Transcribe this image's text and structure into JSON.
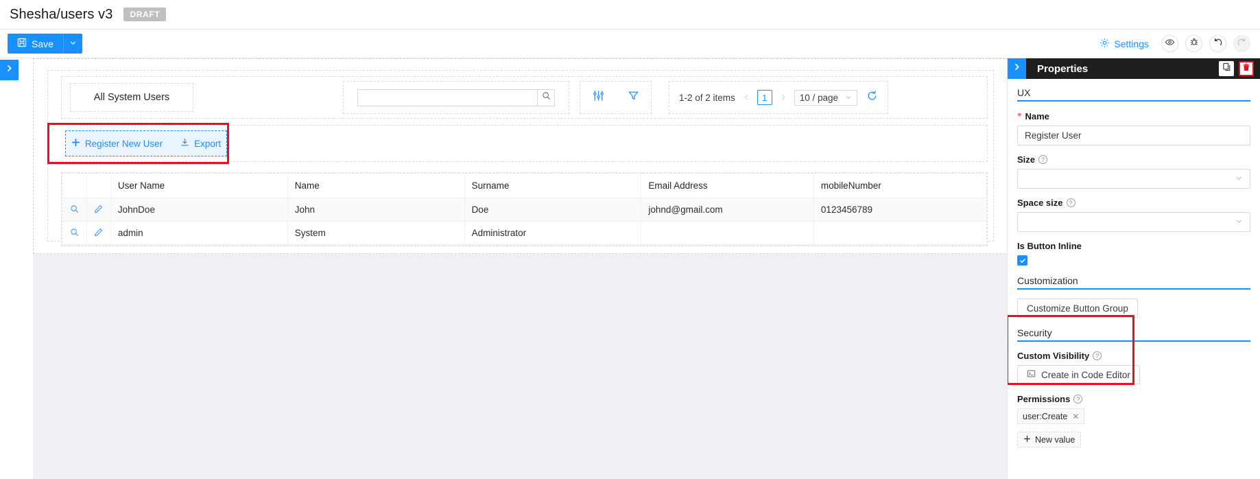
{
  "header": {
    "title": "Shesha/users v3",
    "badge": "DRAFT"
  },
  "toolbar": {
    "save_label": "Save",
    "save_icon": "save-icon",
    "caret_icon": "chevron-down-icon",
    "settings_label": "Settings",
    "settings_icon": "gear-icon",
    "actions": [
      {
        "name": "preview-icon",
        "glyph": "eye"
      },
      {
        "name": "debug-icon",
        "glyph": "bug"
      },
      {
        "name": "undo-icon",
        "glyph": "undo"
      },
      {
        "name": "redo-icon",
        "glyph": "redo"
      }
    ]
  },
  "left_handle": {
    "icon": "chevron-right-icon"
  },
  "canvas": {
    "quickview_label": "All System Users",
    "search": {
      "value": "",
      "placeholder": "",
      "icon": "search-icon"
    },
    "table_icons": [
      {
        "name": "column-settings-icon"
      },
      {
        "name": "filter-icon"
      }
    ],
    "pagination": {
      "range_text": "1-2 of 2 items",
      "prev_icon": "chevron-left-icon",
      "current_page": "1",
      "next_icon": "chevron-right-icon",
      "page_size": "10 / page",
      "page_size_caret": "chevron-down-icon",
      "refresh_icon": "refresh-icon"
    },
    "button_group": {
      "selected": true,
      "buttons": [
        {
          "label": "Register New User",
          "icon": "plus-icon"
        },
        {
          "label": "Export",
          "icon": "download-icon"
        }
      ]
    },
    "table": {
      "columns": [
        "",
        "",
        "User Name",
        "Name",
        "Surname",
        "Email Address",
        "mobileNumber"
      ],
      "row_actions": [
        "view-icon",
        "edit-icon"
      ],
      "rows": [
        {
          "user_name": "JohnDoe",
          "name": "John",
          "surname": "Doe",
          "email": "johnd@gmail.com",
          "mobile": "0123456789"
        },
        {
          "user_name": "admin",
          "name": "System",
          "surname": "Administrator",
          "email": "",
          "mobile": ""
        }
      ]
    }
  },
  "properties": {
    "collapse_icon": "chevron-right-icon",
    "title": "Properties",
    "copy_icon": "copy-icon",
    "delete_icon": "trash-icon",
    "sections": {
      "ux": "UX",
      "customization": "Customization",
      "security": "Security"
    },
    "fields": {
      "name_label": "Name",
      "name_value": "Register User",
      "size_label": "Size",
      "size_value": "",
      "space_size_label": "Space size",
      "space_size_value": "",
      "is_button_inline_label": "Is Button Inline",
      "is_button_inline_checked": true,
      "customize_button_group": "Customize Button Group",
      "custom_visibility_label": "Custom Visibility",
      "create_in_code_editor": "Create in Code Editor",
      "permissions_label": "Permissions",
      "permission_tags": [
        "user:Create"
      ],
      "new_value_label": "New value"
    }
  },
  "colors": {
    "primary": "#1890ff",
    "annotation": "#e81123",
    "panel_header": "#1f1f1f",
    "canvas_bg": "#eef0f4"
  }
}
